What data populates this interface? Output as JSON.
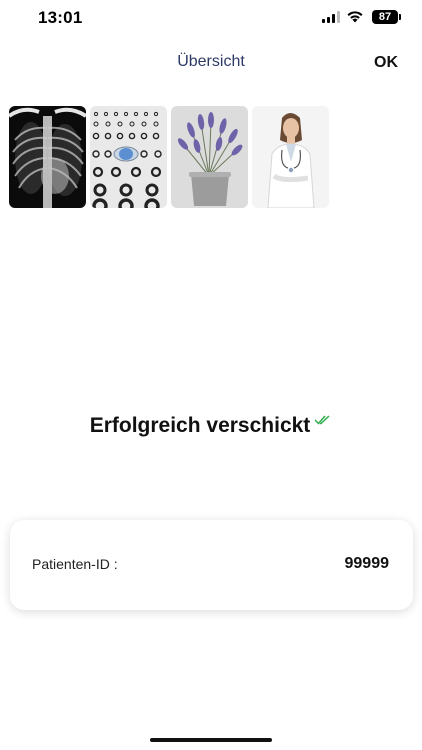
{
  "status_bar": {
    "time": "13:01",
    "battery": "87"
  },
  "nav": {
    "title": "Übersicht",
    "ok_label": "OK"
  },
  "thumbnails": [
    {
      "name": "xray-thumbnail",
      "icon": "chest-xray-image"
    },
    {
      "name": "eye-chart-thumbnail",
      "icon": "landolt-ring-chart-image"
    },
    {
      "name": "lavender-thumbnail",
      "icon": "lavender-plant-image"
    },
    {
      "name": "doctor-thumbnail",
      "icon": "doctor-photo-image"
    }
  ],
  "success": {
    "message": "Erfolgreich verschickt",
    "icon": "double-check-icon",
    "check_color": "#2eae4f"
  },
  "card": {
    "label": "Patienten-ID :",
    "value": "99999"
  },
  "colors": {
    "title": "#2e3a66"
  }
}
